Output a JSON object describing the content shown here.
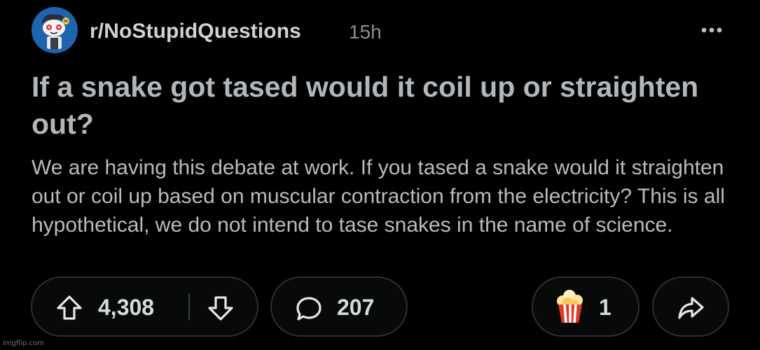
{
  "post": {
    "subreddit": "r/NoStupidQuestions",
    "age": "15h",
    "title": "If a snake got tased would it coil up or straighten out?",
    "body": "We are having this debate at work. If you tased a snake would it straighten out or coil up based on muscular contraction from the electricity? This is all hypothetical, we do not intend to tase snakes in the name of science."
  },
  "actions": {
    "upvote_icon": "upvote-arrow-icon",
    "downvote_icon": "downvote-arrow-icon",
    "score": "4,308",
    "comment_icon": "comment-bubble-icon",
    "comments": "207",
    "award_icon": "popcorn-icon",
    "awards": "1",
    "share_icon": "share-arrow-icon",
    "more_icon": "more-dots-icon"
  },
  "colors": {
    "background": "#000000",
    "pill_border": "#2c2f33",
    "avatar_bg": "#1e63ad",
    "text_primary": "#d7dadc",
    "text_muted": "#8b8e92"
  },
  "watermark": "imgflip.com"
}
